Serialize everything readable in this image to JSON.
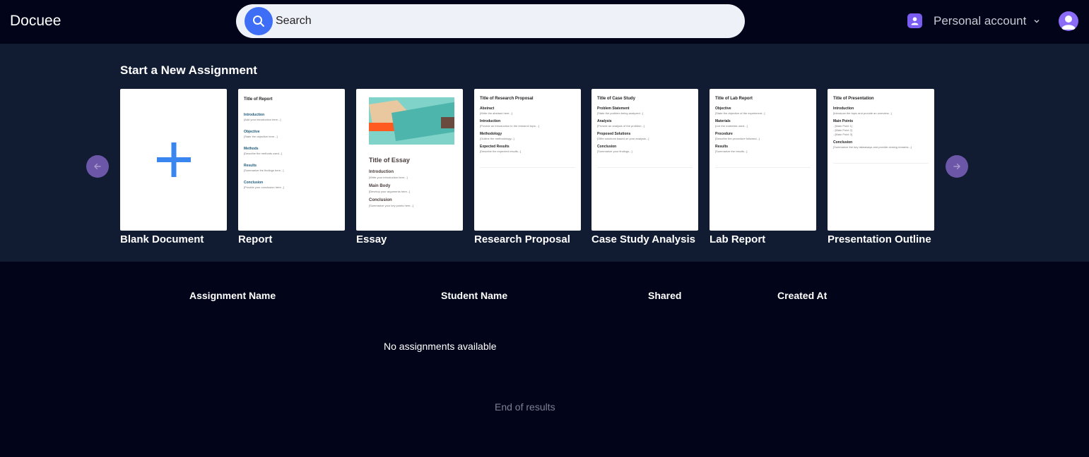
{
  "app": {
    "title": "Docuee"
  },
  "search": {
    "placeholder": "Search",
    "value": ""
  },
  "account": {
    "label": "Personal account"
  },
  "hero": {
    "title": "Start a New Assignment"
  },
  "templates": [
    {
      "label": "Blank Document"
    },
    {
      "label": "Report",
      "doc_title": "Title of Report",
      "sections": [
        {
          "h": "Introduction",
          "p": "[Add your introduction here...]"
        },
        {
          "h": "Objective",
          "p": "[State the objective here...]"
        },
        {
          "h": "Methods",
          "p": "[Describe the methods used...]"
        },
        {
          "h": "Results",
          "p": "[Summarize the findings here...]"
        },
        {
          "h": "Conclusion",
          "p": "[Provide your conclusion here...]"
        }
      ]
    },
    {
      "label": "Essay",
      "doc_title": "Title of Essay",
      "sections": [
        {
          "h": "Introduction",
          "p": "[Write your introduction here...]"
        },
        {
          "h": "Main Body",
          "p": "[Develop your arguments here...]"
        },
        {
          "h": "Conclusion",
          "p": "[Summarize your key points here...]"
        }
      ]
    },
    {
      "label": "Research Proposal",
      "doc_title": "Title of Research Proposal",
      "sections": [
        {
          "h": "Abstract",
          "p": "[Write the abstract here...]"
        },
        {
          "h": "Introduction",
          "p": "[Provide an introduction to the research topic...]"
        },
        {
          "h": "Methodology",
          "p": "[Outline the methodology...]"
        },
        {
          "h": "Expected Results",
          "p": "[Describe the expected results...]"
        }
      ]
    },
    {
      "label": "Case Study Analysis",
      "doc_title": "Title of Case Study",
      "sections": [
        {
          "h": "Problem Statement",
          "p": "[State the problem being analyzed...]"
        },
        {
          "h": "Analysis",
          "p": "[Provide an analysis of the problem...]"
        },
        {
          "h": "Proposed Solutions",
          "p": "[Offer solutions based on your analysis...]"
        },
        {
          "h": "Conclusion",
          "p": "[Summarize your findings...]"
        }
      ]
    },
    {
      "label": "Lab Report",
      "doc_title": "Title of Lab Report",
      "sections": [
        {
          "h": "Objective",
          "p": "[State the objective of the experiment...]"
        },
        {
          "h": "Materials",
          "p": "[List the materials used...]"
        },
        {
          "h": "Procedure",
          "p": "[Describe the procedure followed...]"
        },
        {
          "h": "Results",
          "p": "[Summarize the results...]"
        }
      ]
    },
    {
      "label": "Presentation Outline",
      "doc_title": "Title of Presentation",
      "sections": [
        {
          "h": "Introduction",
          "p": "[Introduce the topic and provide an overview...]"
        },
        {
          "h": "Main Points",
          "p": "- [Main Point 1]",
          "p2": "- [Main Point 2]",
          "p3": "- [Main Point 3]"
        },
        {
          "h": "Conclusion",
          "p": "[Summarize the key takeaways and provide closing remarks...]"
        }
      ]
    }
  ],
  "table": {
    "columns": [
      "Assignment Name",
      "Student Name",
      "Shared",
      "Created At"
    ],
    "empty_message": "No assignments available",
    "end_message": "End of results"
  },
  "colors": {
    "accent": "#3d6ef5",
    "background": "#02051a",
    "hero_bg": "#111c33",
    "arrow": "#6b56a8"
  }
}
